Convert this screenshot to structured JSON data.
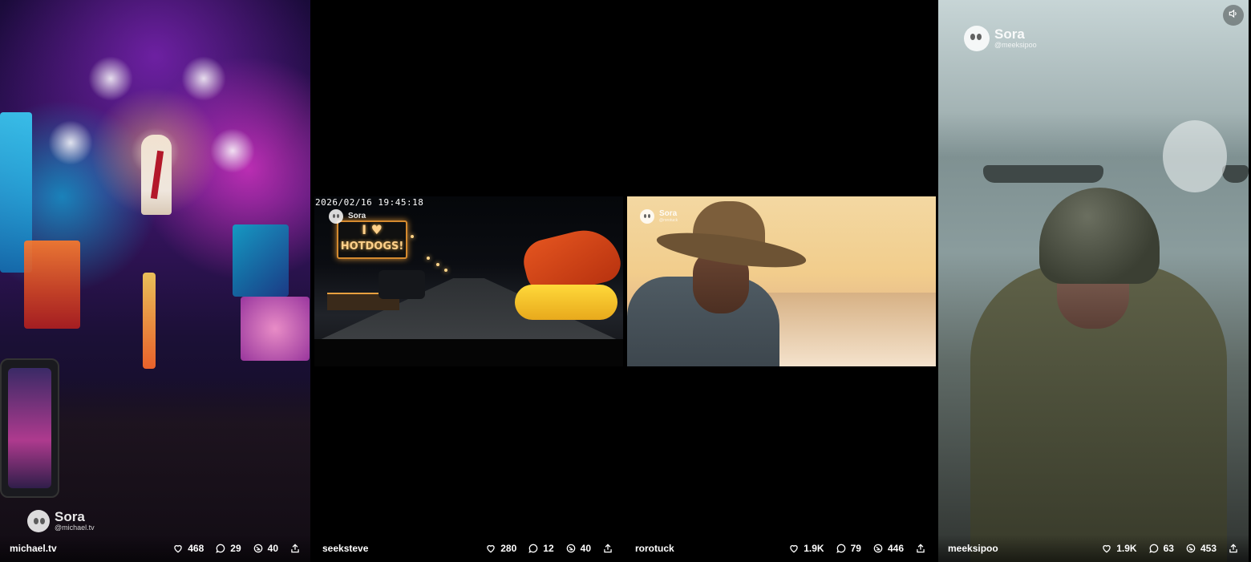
{
  "tiles": [
    {
      "username": "michael.tv",
      "likes": "468",
      "comments": "29",
      "remixes": "40",
      "watermark": {
        "brand": "Sora",
        "handle": "@michael.tv"
      }
    },
    {
      "username": "seeksteve",
      "likes": "280",
      "comments": "12",
      "remixes": "40",
      "watermark": {
        "brand": "Sora",
        "handle": ""
      },
      "timestamp": "2026/02/16 19:45:18",
      "sign": {
        "line1": "I ♥",
        "line2": "HOTDOGS!"
      }
    },
    {
      "username": "rorotuck",
      "likes": "1.9K",
      "comments": "79",
      "remixes": "446",
      "watermark": {
        "brand": "Sora",
        "handle": "@rorotuck"
      }
    },
    {
      "username": "meeksipoo",
      "likes": "1.9K",
      "comments": "63",
      "remixes": "453",
      "watermark": {
        "brand": "Sora",
        "handle": "@meeksipoo"
      }
    }
  ],
  "icons": {
    "like": "heart-icon",
    "comment": "comment-bubble-icon",
    "remix": "remix-icon",
    "share": "share-icon",
    "sound": "speaker-icon"
  },
  "colors": {
    "background": "#000000",
    "text": "#ffffff"
  }
}
